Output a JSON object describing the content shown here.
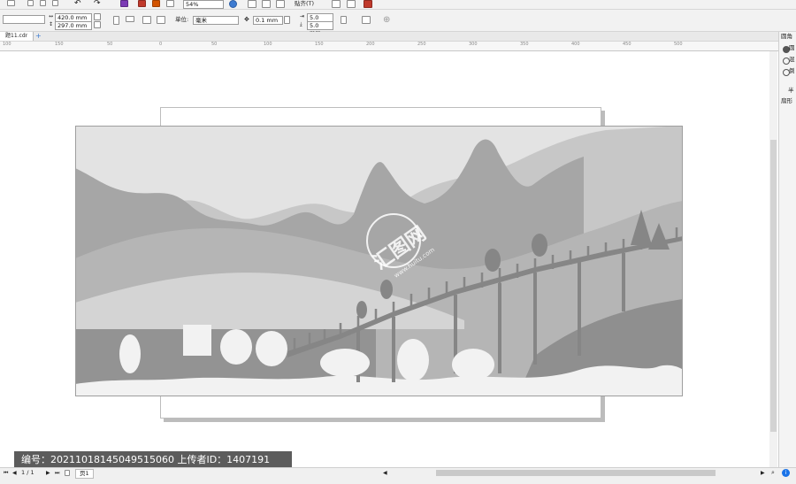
{
  "toolbar": {
    "zoom": "54%",
    "paste_label": "贴齐(T)",
    "width": "420.0 mm",
    "height": "297.0 mm",
    "units_label": "单位:",
    "units_value": "毫米",
    "nudge": "0.1 mm",
    "dup_x": "5.0 mm",
    "dup_y": "5.0 mm"
  },
  "document": {
    "tab": "题11.cdr"
  },
  "ruler": {
    "ticks": [
      "100",
      "150",
      "50",
      "0",
      "50",
      "100",
      "150",
      "200",
      "250",
      "300",
      "350",
      "400",
      "450",
      "500"
    ]
  },
  "panel": {
    "title": "圆角",
    "options": [
      "圆",
      "混",
      "倒"
    ],
    "label1": "半",
    "label2": "扇形"
  },
  "status": {
    "page_count": "1 / 1",
    "page_tab": "页1"
  },
  "watermark": {
    "text": "编号：20211018145049515060 上传者ID：1407191",
    "brand": "汇图网",
    "url": "www.huitu.com"
  },
  "colors": {
    "sky": "#e3e3e3",
    "far_mountains": "#c7c7c7",
    "mid_mountains": "#a6a6a6",
    "dark_silhouettes": "#868686",
    "foreground": "#f2f2f2",
    "accent": "#1a73e8"
  }
}
